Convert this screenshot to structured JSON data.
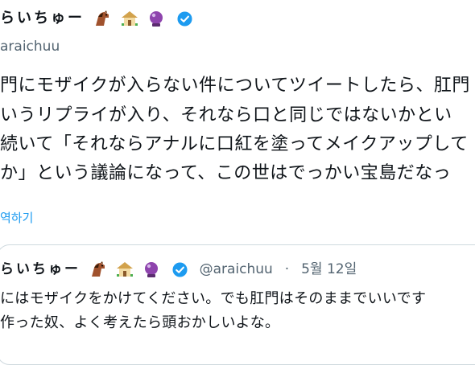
{
  "tweet": {
    "display_name": "らいちゅー",
    "handle": "araichuu",
    "body_lines": [
      "門にモザイクが入らない件についてツイートしたら、肛門",
      "いうリプライが入り、それなら口と同じではないかとい",
      "続いて「それならアナルに口紅を塗ってメイクアップして",
      "か」という議論になって、この世はでっかい宝島だなっ"
    ],
    "translate_label": "역하기"
  },
  "quoted_tweet": {
    "display_name": "らいちゅー",
    "handle": "@araichuu",
    "separator": "·",
    "date": "5월 12일",
    "body_lines": [
      "にはモザイクをかけてください。でも肛門はそのままでいいです",
      "作った奴、よく考えたら頭おかしいよな。"
    ]
  },
  "colors": {
    "text": "#0f1419",
    "secondary": "#536471",
    "link": "#1d9bf0",
    "verified": "#1d9bf0",
    "border": "#cfd9de"
  },
  "icons": [
    "horse-emoji-icon",
    "house-emoji-icon",
    "crystal-ball-emoji-icon",
    "verified-badge-icon"
  ]
}
